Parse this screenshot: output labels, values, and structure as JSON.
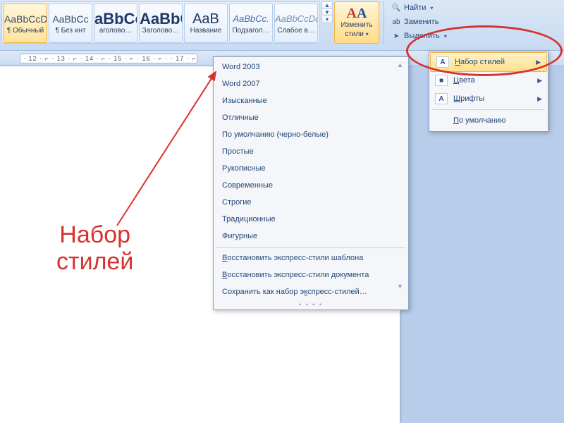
{
  "ribbon": {
    "styles": [
      {
        "preview": "AaBbCcDd",
        "label": "¶ Обычный",
        "kind": "normal",
        "selected": true
      },
      {
        "preview": "AaBbCc",
        "label": "¶ Без инт",
        "kind": "normal"
      },
      {
        "preview": "aBbCc",
        "label": "аголово…",
        "kind": "big"
      },
      {
        "preview": "AaBbCc",
        "label": "Заголово…",
        "kind": "big"
      },
      {
        "preview": "AaB",
        "label": "Название",
        "kind": "name"
      },
      {
        "preview": "AaBbCc.",
        "label": "Подзагол…",
        "kind": "sub"
      },
      {
        "preview": "AaBbCcDd",
        "label": "Слабое в…",
        "kind": "weak"
      }
    ],
    "change_styles": {
      "label_line1": "Изменить",
      "label_line2": "стили"
    },
    "editing": {
      "find": "Найти",
      "replace": "Заменить",
      "select": "Выделить"
    }
  },
  "ruler": {
    "text": "· 12 · ⌐ · 13 · ⌐ · 14 · ⌐ · 15 · ⌐ · 16 · ⌐ ·  · 17 · ⌐ · "
  },
  "styleset_menu": {
    "items": [
      "Word 2003",
      "Word 2007",
      "Изысканные",
      "Отличные",
      "По умолчанию (черно-белые)",
      "Простые",
      "Рукописные",
      "Современные",
      "Строгие",
      "Традиционные",
      "Фигурные"
    ],
    "footer": [
      {
        "u": "В",
        "rest": "осстановить экспресс-стили шаблона"
      },
      {
        "u": "В",
        "rest": "осстановить экспресс-стили документа"
      },
      {
        "u": "",
        "rest": "Сохранить как набор э",
        "u2": "к",
        "rest2": "спресс-стилей…"
      }
    ]
  },
  "submenu": {
    "rows": [
      {
        "icon": "A",
        "u": "Н",
        "rest": "абор стилей",
        "arrow": true,
        "hl": true
      },
      {
        "icon": "■",
        "u": "Ц",
        "rest": "вета",
        "arrow": true
      },
      {
        "icon": "A",
        "u": "Ш",
        "rest": "рифты",
        "arrow": true
      }
    ],
    "default": {
      "u": "П",
      "rest": "о умолчанию"
    }
  },
  "annotation": {
    "line1": "Набор",
    "line2": "стилей"
  }
}
